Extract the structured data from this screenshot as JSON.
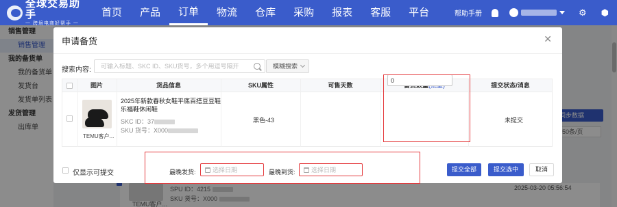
{
  "app": {
    "logo_title": "全球交易助手",
    "logo_subtitle": "一 跨境电商好帮手 一"
  },
  "nav": {
    "items": [
      "首页",
      "产品",
      "订单",
      "物流",
      "仓库",
      "采购",
      "报表",
      "客服",
      "平台"
    ],
    "active": "订单",
    "help": "帮助手册"
  },
  "sidebar": {
    "groups": [
      {
        "label": "销售管理",
        "items": [
          "销售管理"
        ]
      },
      {
        "label": "我的备货单",
        "items": [
          "我的备货单",
          "发货台",
          "发货单列表"
        ]
      },
      {
        "label": "发货管理",
        "items": [
          "出库单"
        ]
      }
    ],
    "active": "销售管理"
  },
  "background": {
    "sync_button": "同步数据",
    "page_size": "50条/页",
    "thumb_label": "TEMU客户...",
    "spu_prefix": "SPU ID：4215",
    "sku_prefix": "SKU 货号：X000",
    "timestamp": "2025-03-20 05:56:54"
  },
  "modal": {
    "title": "申请备货",
    "close_icon": "close-icon",
    "search": {
      "label": "搜索内容:",
      "placeholder": "可输入标题、SKC ID、SKU货号，多个用逗号隔开",
      "value": "",
      "mode": "模糊搜索"
    },
    "table": {
      "headers": {
        "image": "图片",
        "product_info": "货品信息",
        "sku_attr": "SKU属性",
        "available_days": "可售天数",
        "stock_qty": "备货数量",
        "batch": "(批量)",
        "submit_status": "提交状态/消息"
      },
      "rows": [
        {
          "image_label": "TEMU客户...",
          "title": "2025年新款春秋女鞋平底百搭豆豆鞋乐福鞋休闲鞋",
          "skc_prefix": "SKC ID：37",
          "sku_prefix": "SKU 货号：X000",
          "sku_attr": "黑色-43",
          "available_days": "",
          "quantity": "0",
          "status": "未提交"
        }
      ]
    },
    "footer": {
      "only_submittable_label": "仅显示可提交",
      "latest_ship_label": "最晚发货:",
      "latest_arrival_label": "最晚到货:",
      "date_placeholder": "选择日期",
      "submit_all": "提交全部",
      "submit_selected": "提交选中",
      "cancel": "取消"
    }
  },
  "colors": {
    "primary": "#3a5ccb",
    "highlight_red": "#e4393c"
  }
}
